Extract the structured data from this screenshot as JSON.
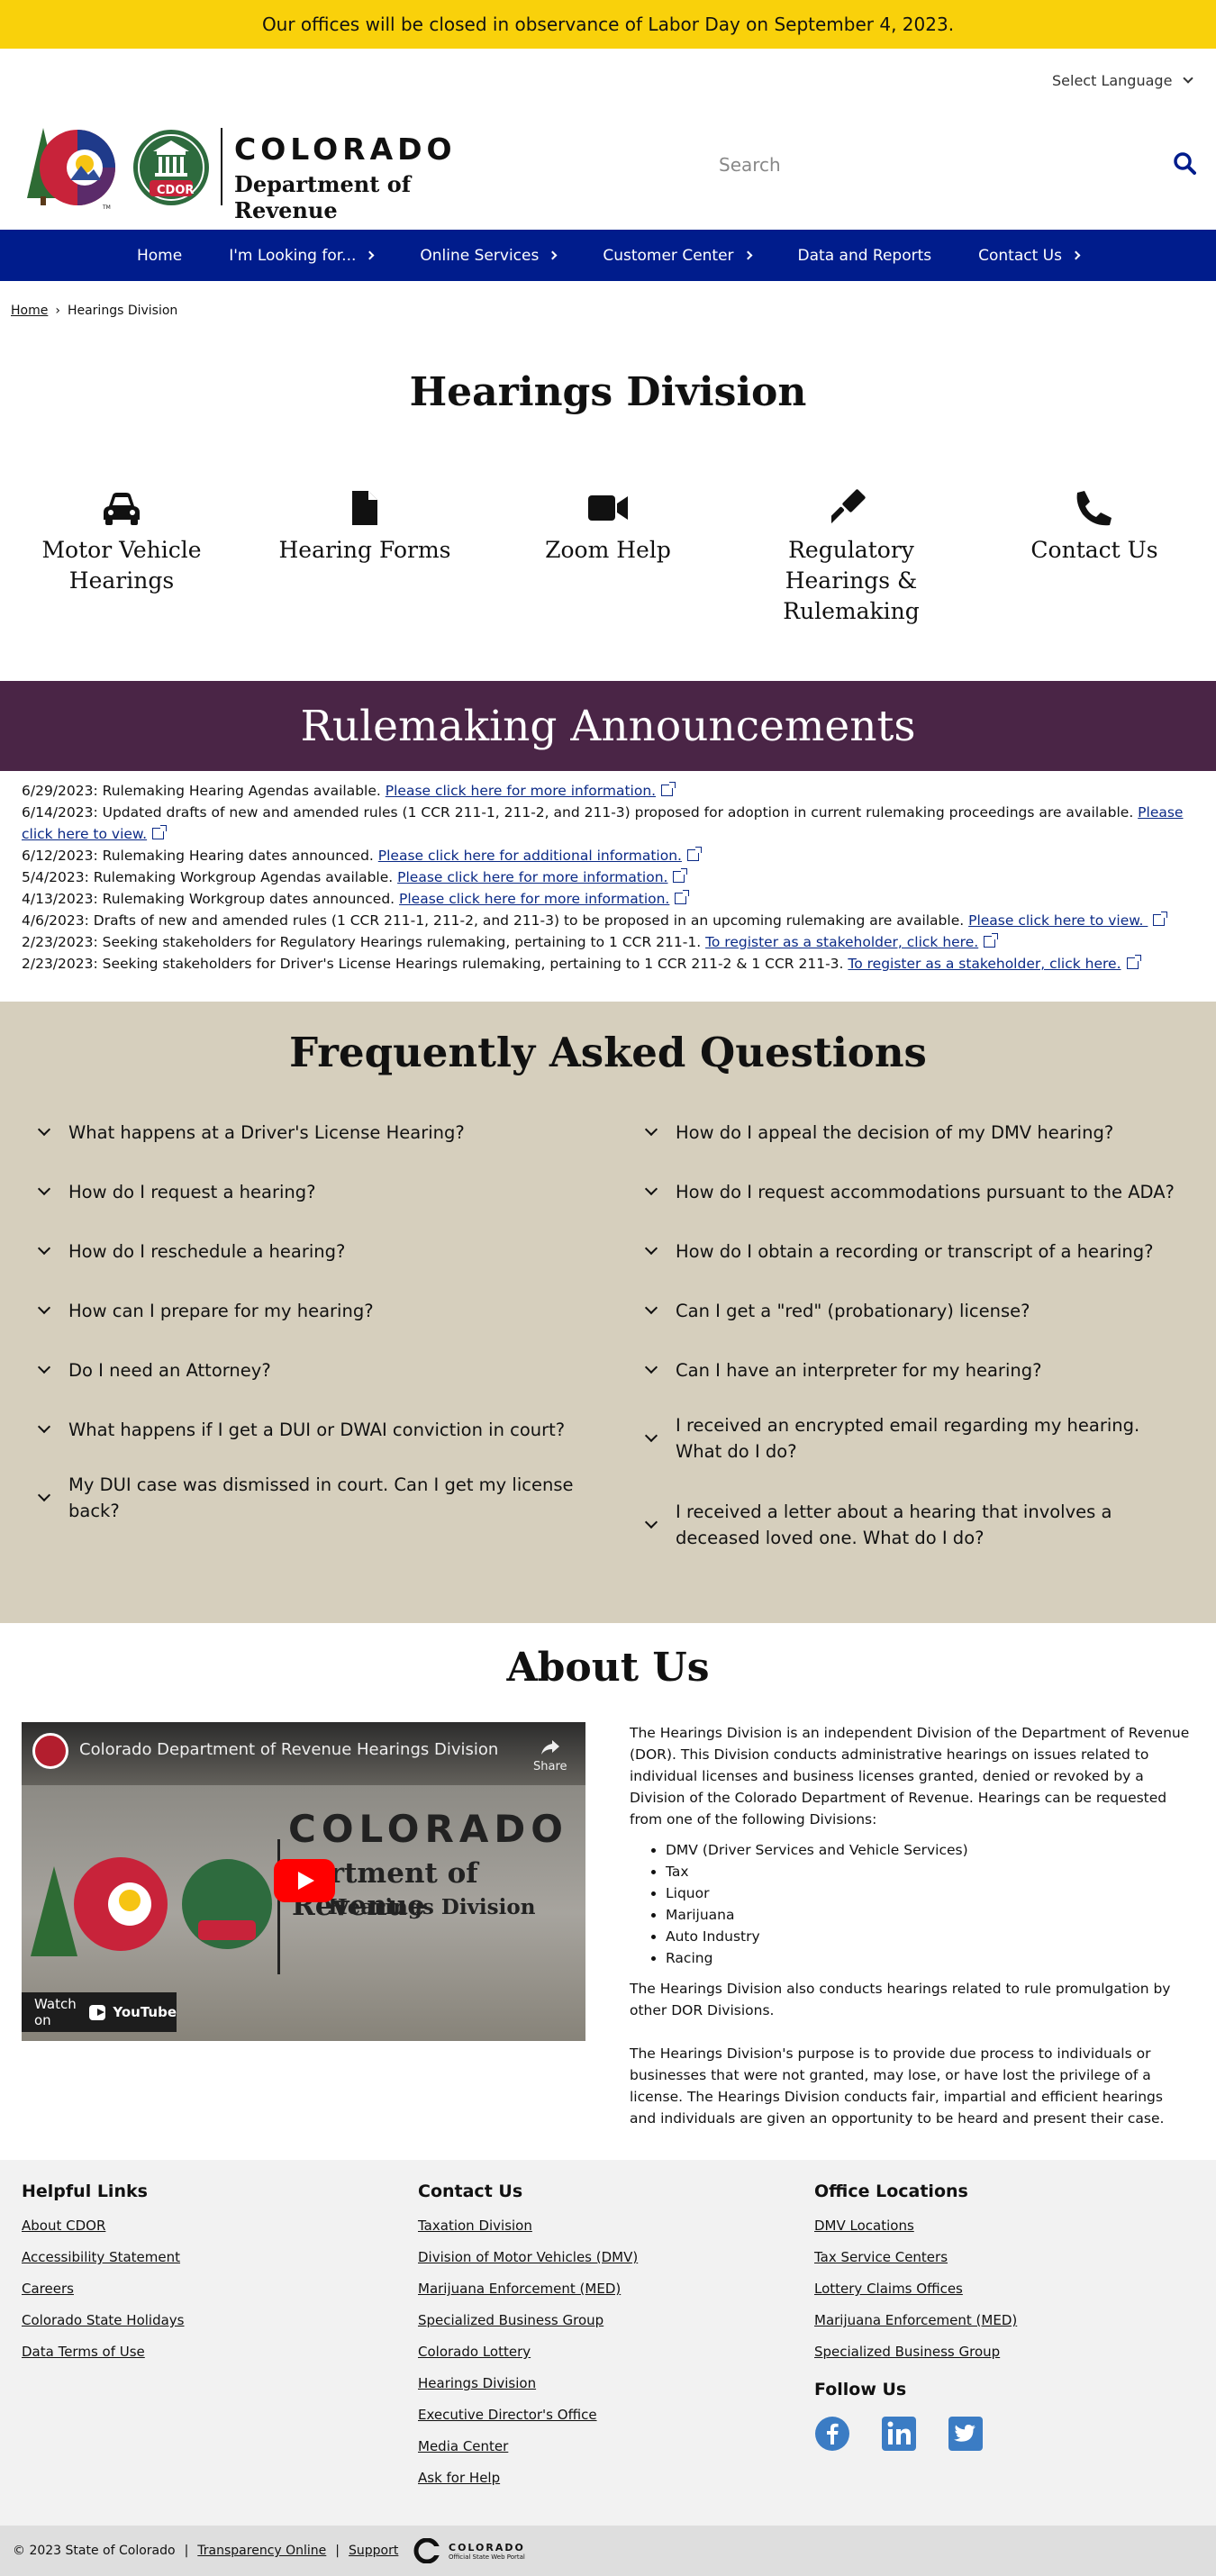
{
  "alert": {
    "text": "Our offices will be closed in observance of Labor Day on September 4, 2023."
  },
  "header": {
    "language_label": "Select Language",
    "logo_title": "COLORADO",
    "logo_subtitle": "Department of Revenue",
    "logo_badge": "CDOR",
    "search_placeholder": "Search"
  },
  "nav": {
    "items": [
      {
        "label": "Home"
      },
      {
        "label": "I'm Looking for..."
      },
      {
        "label": "Online Services"
      },
      {
        "label": "Customer Center"
      },
      {
        "label": "Data and Reports"
      },
      {
        "label": "Contact Us"
      }
    ]
  },
  "breadcrumb": {
    "home": "Home",
    "separator": "›",
    "current": "Hearings Division"
  },
  "page": {
    "title": "Hearings Division"
  },
  "tiles": [
    {
      "label": "Motor Vehicle Hearings",
      "icon": "car-icon"
    },
    {
      "label": "Hearing Forms",
      "icon": "document-icon"
    },
    {
      "label": "Zoom Help",
      "icon": "video-camera-icon"
    },
    {
      "label": "Regulatory Hearings & Rulemaking",
      "icon": "gavel-icon"
    },
    {
      "label": "Contact Us",
      "icon": "phone-icon"
    }
  ],
  "announcements": {
    "title": "Rulemaking Announcements",
    "items": [
      {
        "text": "6/29/2023: Rulemaking Hearing Agendas available. ",
        "link": "Please click here for more information."
      },
      {
        "text": "6/14/2023: Updated drafts of new and amended rules (1 CCR 211-1, 211-2, and 211-3) proposed for adoption in current rulemaking proceedings are available. ",
        "link": "Please click here to view."
      },
      {
        "text": "6/12/2023: Rulemaking Hearing dates announced. ",
        "link": "Please click here for additional information."
      },
      {
        "text": "5/4/2023: Rulemaking Workgroup Agendas available. ",
        "link": "Please click here for more information."
      },
      {
        "text": "4/13/2023: Rulemaking Workgroup dates announced. ",
        "link": "Please click here for more information."
      },
      {
        "text": "4/6/2023: Drafts of new and amended rules (1 CCR 211-1, 211-2, and 211-3) to be proposed in an upcoming rulemaking are available. ",
        "link": "Please click here to view. "
      },
      {
        "text": "2/23/2023: Seeking stakeholders for Regulatory Hearings rulemaking, pertaining to 1 CCR 211-1. ",
        "link": "To register as a stakeholder, click here."
      },
      {
        "text": "2/23/2023: Seeking stakeholders for Driver's License Hearings rulemaking, pertaining to 1 CCR 211-2 & 1 CCR 211-3. ",
        "link": "To register as a stakeholder, click here."
      }
    ]
  },
  "faq": {
    "title": "Frequently Asked Questions",
    "left": [
      "What happens at a Driver's License Hearing?",
      "How do I request a hearing?",
      "How do I reschedule a hearing?",
      "How can I prepare for my hearing?",
      "Do I need an Attorney?",
      "What happens if I get a DUI or DWAI conviction in court?",
      "My DUI case was dismissed in court. Can I get my license back?"
    ],
    "right": [
      "How do I appeal the decision of my DMV hearing?",
      "How do I request accommodations pursuant to the ADA?",
      "How do I obtain a recording or transcript of a hearing?",
      "Can I get a \"red\" (probationary) license?",
      "Can I have an interpreter for my hearing?",
      "I received an encrypted email regarding my hearing. What do I do?",
      "I received a letter about a hearing that involves a deceased loved one. What do I do?"
    ]
  },
  "about": {
    "title": "About Us",
    "video": {
      "title": "Colorado Department of Revenue Hearings Division Introdu...",
      "share": "Share",
      "overlay_title": "COLORADO",
      "overlay_dept": "partment of Revenue",
      "overlay_division": "Hearings Division",
      "watch_on": "Watch on",
      "youtube": "YouTube"
    },
    "intro": "The Hearings Division is an independent Division of the Department of Revenue (DOR). This Division conducts administrative hearings on issues related to individual licenses and business licenses granted, denied or revoked by a Division of the Colorado Department of Revenue. Hearings can be requested from one of the following Divisions:",
    "divisions": [
      "DMV (Driver Services and Vehicle Services)",
      "Tax",
      "Liquor",
      "Marijuana",
      "Auto Industry",
      "Racing"
    ],
    "para2": "The Hearings Division also conducts hearings related to rule promulgation by other DOR Divisions.",
    "para3": "The Hearings Division's purpose is to provide due process to individuals or businesses that were not granted, may lose, or have lost the privilege of a license. The Hearings Division conducts fair, impartial and efficient hearings and individuals are given an opportunity to be heard and present their case."
  },
  "footer": {
    "helpful": {
      "title": "Helpful Links",
      "links": [
        "About CDOR",
        "Accessibility Statement",
        "Careers",
        "Colorado State Holidays",
        "Data Terms of Use"
      ]
    },
    "contact": {
      "title": "Contact Us",
      "links": [
        "Taxation Division",
        "Division of Motor Vehicles (DMV)",
        "Marijuana Enforcement (MED)",
        "Specialized Business Group",
        "Colorado Lottery",
        "Hearings Division",
        "Executive Director's Office",
        "Media Center",
        "Ask for Help"
      ]
    },
    "offices": {
      "title": "Office Locations",
      "links": [
        "DMV Locations",
        "Tax Service Centers",
        "Lottery Claims Offices",
        "Marijuana Enforcement (MED)",
        "Specialized Business Group"
      ]
    },
    "follow": {
      "title": "Follow Us",
      "icons": [
        "facebook-icon",
        "linkedin-icon",
        "twitter-icon"
      ]
    }
  },
  "bottom": {
    "copyright": "© 2023 State of Colorado",
    "sep": "|",
    "transparency": "Transparency Online",
    "support": "Support",
    "state_logo": "COLORADO",
    "state_logo_sub": "Official State Web Portal"
  },
  "colors": {
    "alert": "#f9d10b",
    "nav": "#001c8c",
    "announce": "#4a2546",
    "faq": "#d6cfbd",
    "footer": "#f2f2f2"
  }
}
